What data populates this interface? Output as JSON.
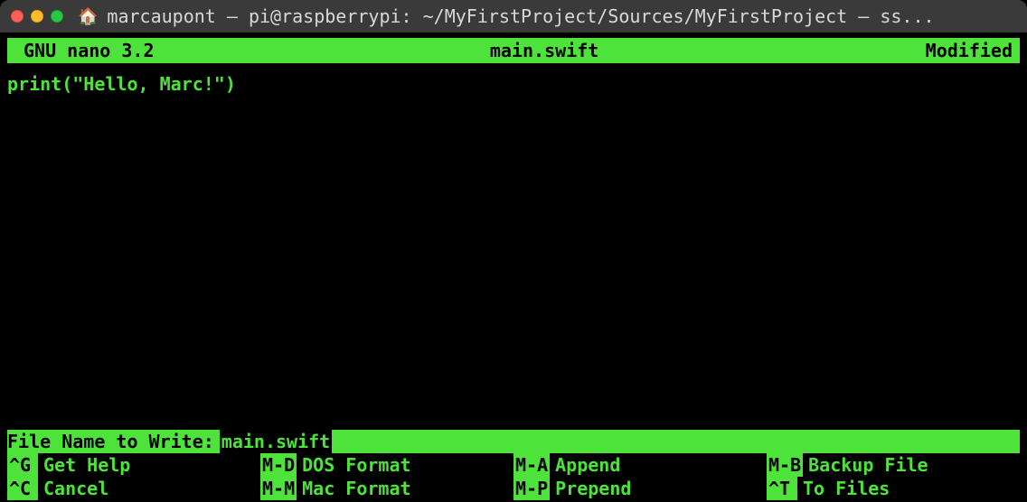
{
  "window": {
    "title": "marcaupont — pi@raspberrypi: ~/MyFirstProject/Sources/MyFirstProject — ss..."
  },
  "nano": {
    "app": "GNU nano 3.2",
    "filename": "main.swift",
    "status": "Modified",
    "content": "print(\"Hello, Marc!\")",
    "prompt_label": "File Name to Write: ",
    "prompt_value": "main.swift"
  },
  "shortcuts": [
    {
      "key": "^G",
      "label": "Get Help"
    },
    {
      "key": "M-D",
      "label": "DOS Format"
    },
    {
      "key": "M-A",
      "label": "Append"
    },
    {
      "key": "M-B",
      "label": "Backup File"
    },
    {
      "key": "^C",
      "label": "Cancel"
    },
    {
      "key": "M-M",
      "label": "Mac Format"
    },
    {
      "key": "M-P",
      "label": "Prepend"
    },
    {
      "key": "^T",
      "label": "To Files"
    }
  ]
}
